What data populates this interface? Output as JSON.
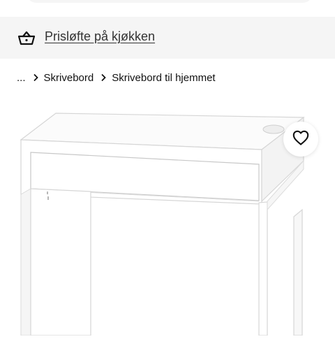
{
  "promo": {
    "icon": "basket-icon",
    "link_text": "Prisløfte på kjøkken"
  },
  "breadcrumb": {
    "items": [
      {
        "label": "...",
        "separator_icon": "chevron-right-icon"
      },
      {
        "label": "Skrivebord",
        "separator_icon": "chevron-right-icon"
      },
      {
        "label": "Skrivebord til hjemmet"
      }
    ]
  },
  "product": {
    "image_subject": "white-desk-with-drawer",
    "favorite_icon": "heart-outline-icon"
  },
  "colors": {
    "promo_background": "#f5f5f5",
    "text": "#111111",
    "link": "#333333"
  }
}
